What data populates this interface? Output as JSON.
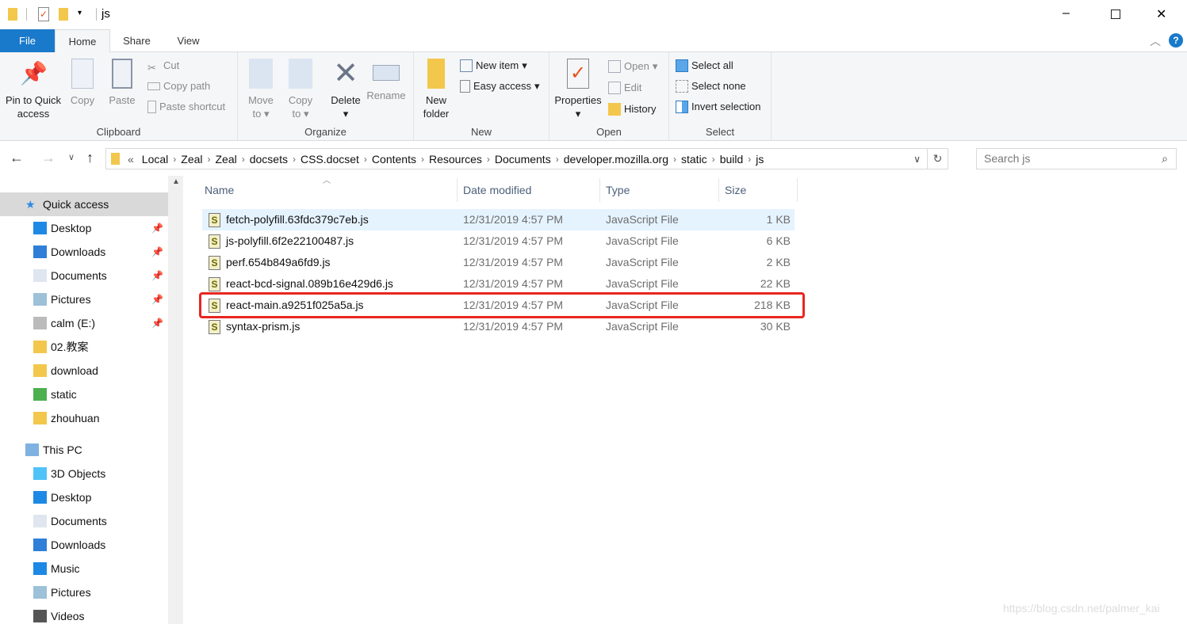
{
  "window": {
    "title": "js",
    "minimize": "–",
    "maximize": "☐",
    "close": "✕"
  },
  "ribbon_tabs": [
    "File",
    "Home",
    "Share",
    "View"
  ],
  "ribbon": {
    "clipboard": {
      "label": "Clipboard",
      "pin": "Pin to Quick access",
      "copy": "Copy",
      "paste": "Paste",
      "cut": "Cut",
      "copy_path": "Copy path",
      "paste_shortcut": "Paste shortcut"
    },
    "organize": {
      "label": "Organize",
      "move_to": "Move to",
      "copy_to": "Copy to",
      "delete": "Delete",
      "rename": "Rename"
    },
    "new": {
      "label": "New",
      "new_folder": "New folder",
      "new_item": "New item",
      "easy_access": "Easy access"
    },
    "open": {
      "label": "Open",
      "properties": "Properties",
      "open": "Open",
      "edit": "Edit",
      "history": "History"
    },
    "select": {
      "label": "Select",
      "select_all": "Select all",
      "select_none": "Select none",
      "invert": "Invert selection"
    }
  },
  "address": {
    "overflow": "«",
    "crumbs": [
      "Local",
      "Zeal",
      "Zeal",
      "docsets",
      "CSS.docset",
      "Contents",
      "Resources",
      "Documents",
      "developer.mozilla.org",
      "static",
      "build",
      "js"
    ]
  },
  "search": {
    "placeholder": "Search js"
  },
  "nav": {
    "quick_access": "Quick access",
    "quick_items": [
      {
        "label": "Desktop",
        "pinned": true
      },
      {
        "label": "Downloads",
        "pinned": true
      },
      {
        "label": "Documents",
        "pinned": true
      },
      {
        "label": "Pictures",
        "pinned": true
      },
      {
        "label": "calm (E:)",
        "pinned": true
      },
      {
        "label": "02.教案"
      },
      {
        "label": "download"
      },
      {
        "label": "static"
      },
      {
        "label": "zhouhuan"
      }
    ],
    "this_pc": "This PC",
    "pc_items": [
      "3D Objects",
      "Desktop",
      "Documents",
      "Downloads",
      "Music",
      "Pictures",
      "Videos"
    ]
  },
  "columns": {
    "name": "Name",
    "date": "Date modified",
    "type": "Type",
    "size": "Size"
  },
  "files": [
    {
      "name": "fetch-polyfill.63fdc379c7eb.js",
      "date": "12/31/2019 4:57 PM",
      "type": "JavaScript File",
      "size": "1 KB",
      "hover": true
    },
    {
      "name": "js-polyfill.6f2e22100487.js",
      "date": "12/31/2019 4:57 PM",
      "type": "JavaScript File",
      "size": "6 KB"
    },
    {
      "name": "perf.654b849a6fd9.js",
      "date": "12/31/2019 4:57 PM",
      "type": "JavaScript File",
      "size": "2 KB"
    },
    {
      "name": "react-bcd-signal.089b16e429d6.js",
      "date": "12/31/2019 4:57 PM",
      "type": "JavaScript File",
      "size": "22 KB"
    },
    {
      "name": "react-main.a9251f025a5a.js",
      "date": "12/31/2019 4:57 PM",
      "type": "JavaScript File",
      "size": "218 KB",
      "highlighted": true
    },
    {
      "name": "syntax-prism.js",
      "date": "12/31/2019 4:57 PM",
      "type": "JavaScript File",
      "size": "30 KB"
    }
  ],
  "watermark": "https://blog.csdn.net/palmer_kai",
  "colors": {
    "accent": "#1979ca",
    "highlight_box": "#e8261f",
    "hover_row": "#e5f3ff",
    "nav_selected": "#d9d9d9"
  }
}
